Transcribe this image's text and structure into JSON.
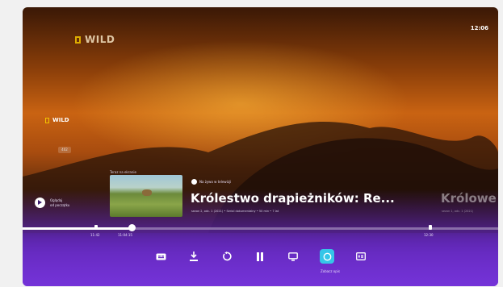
{
  "clock": "12:06",
  "brand": {
    "top_logo_text": "WILD",
    "channel_logo_text": "WILD",
    "channel_number": "402"
  },
  "restart": {
    "line1": "Oglądaj",
    "line2": "od początku"
  },
  "next_section_label": "Teraz na ekranie",
  "live_badge": "Na żywo w telewizji",
  "program": {
    "title": "Królestwo drapieżników: Re...",
    "meta": "sezon 2, odc. 1 (2021) • Serial dokumentalny • 50 min • 7 lat"
  },
  "next_program": {
    "title": "Królowe",
    "meta": "sezon 1, odc. 1 (2021)"
  },
  "progress": {
    "played_fraction": 0.23,
    "current_label": "11:42",
    "start_label": "11:04:15",
    "end_label": "12:30"
  },
  "controls": [
    {
      "name": "subtitles",
      "icon": "cc-icon"
    },
    {
      "name": "record",
      "icon": "download-icon"
    },
    {
      "name": "restart",
      "icon": "replay-icon"
    },
    {
      "name": "pause",
      "icon": "pause-icon"
    },
    {
      "name": "guide",
      "icon": "tv-guide-icon"
    },
    {
      "name": "similar",
      "icon": "circle-icon"
    },
    {
      "name": "more",
      "icon": "info-icon"
    }
  ],
  "active_control_caption": "Zobacz opis",
  "colors": {
    "accent_cyan": "#35c6e8",
    "purple": "#7433d8",
    "brand_yellow": "#f2c300"
  }
}
